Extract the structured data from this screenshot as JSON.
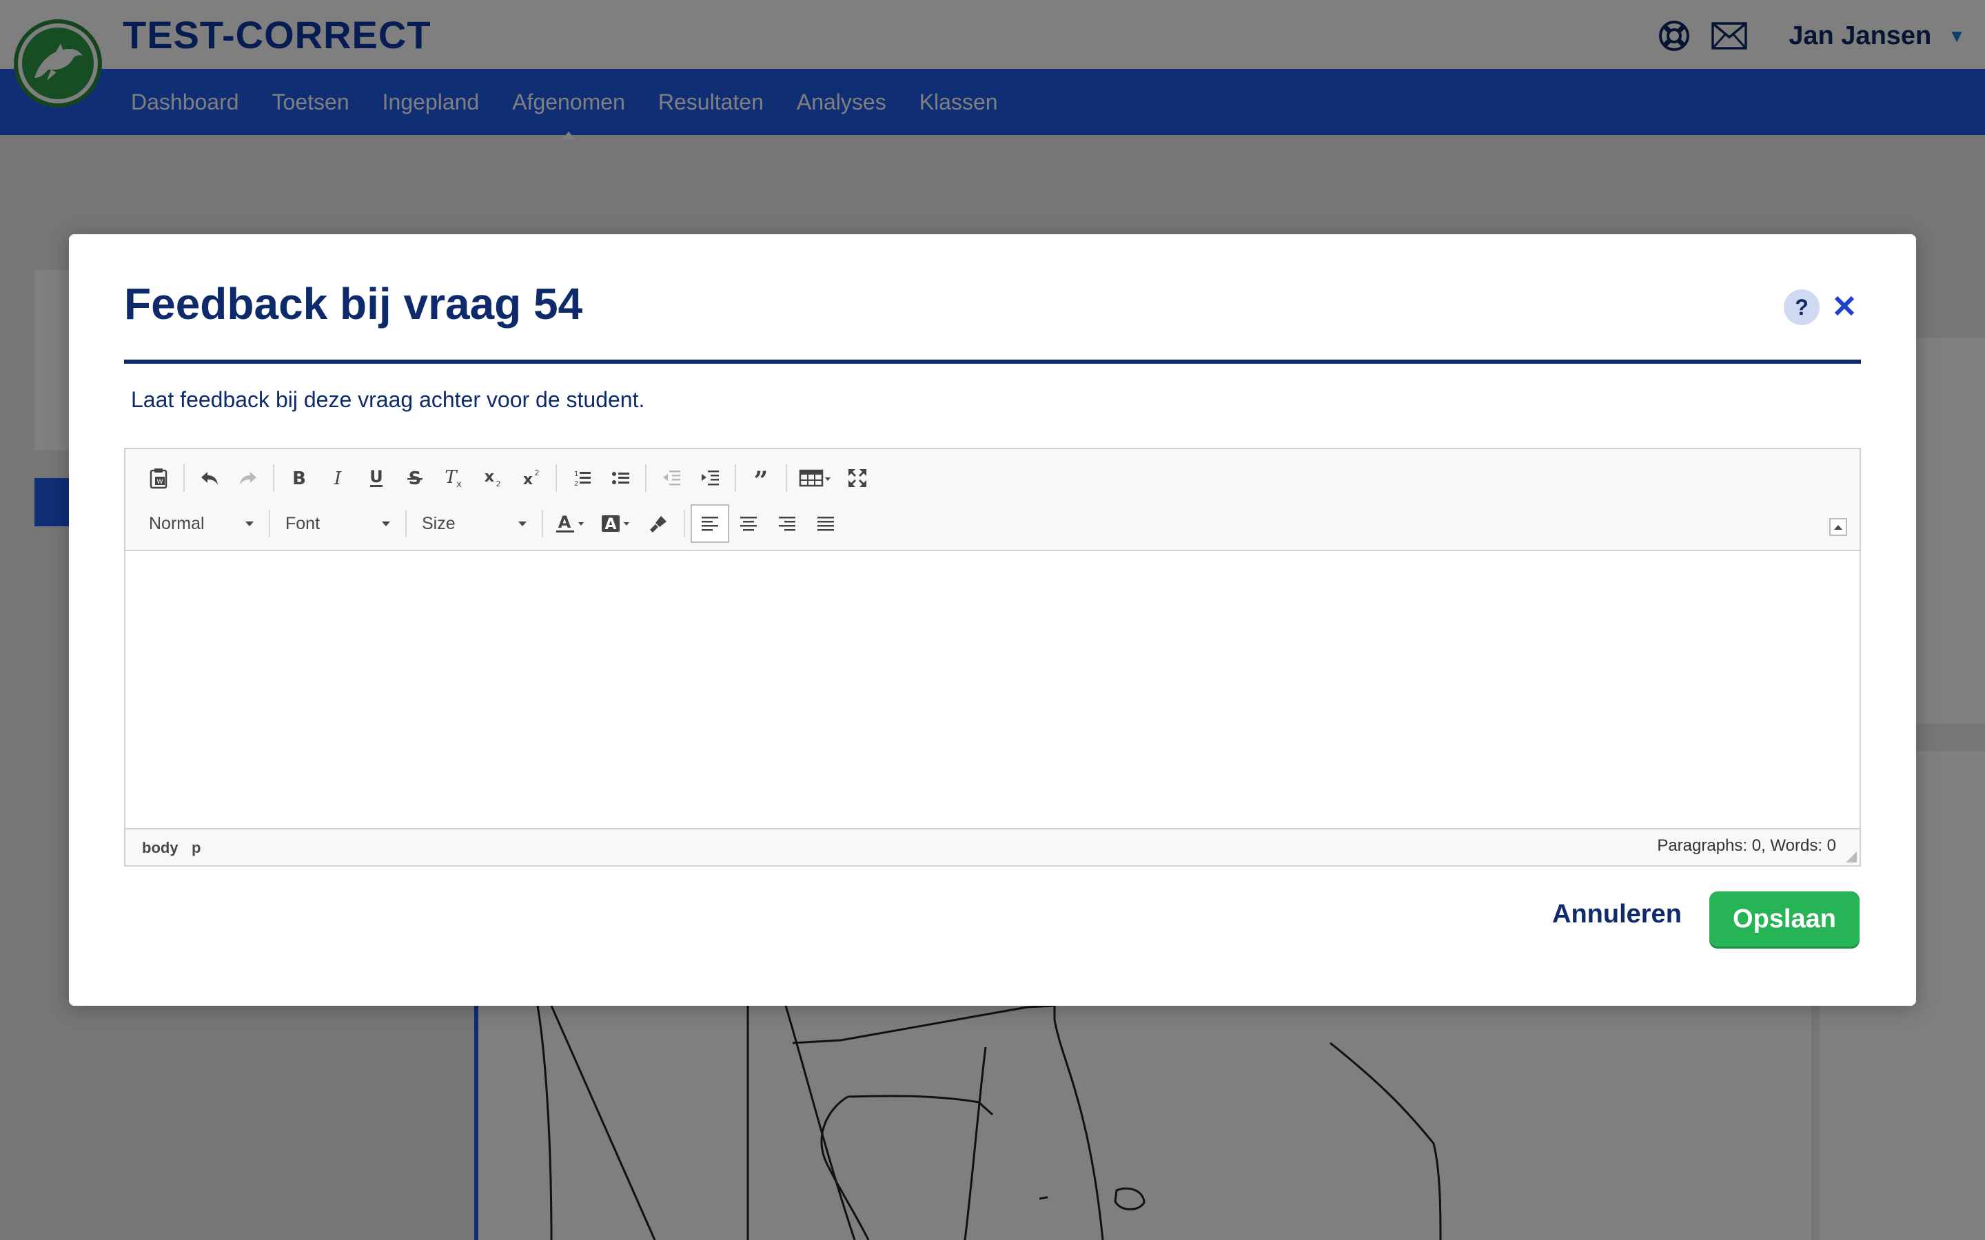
{
  "app": {
    "brand": "TEST-CORRECT",
    "user_name": "Jan Jansen",
    "nav": [
      {
        "label": "Dashboard"
      },
      {
        "label": "Toetsen"
      },
      {
        "label": "Ingepland"
      },
      {
        "label": "Afgenomen",
        "active": true
      },
      {
        "label": "Resultaten"
      },
      {
        "label": "Analyses"
      },
      {
        "label": "Klassen"
      }
    ],
    "icons": {
      "support": "lifebuoy-icon",
      "messages": "envelope-icon",
      "user_menu": "caret-down-icon",
      "logo": "dolphin-logo"
    },
    "colors": {
      "brand_blue": "#1f5ce8",
      "navy": "#0e2a6b",
      "save_green": "#27b456"
    }
  },
  "modal": {
    "title": "Feedback bij vraag 54",
    "description": "Laat feedback bij deze vraag achter voor de student.",
    "help_label": "?",
    "cancel_label": "Annuleren",
    "save_label": "Opslaan"
  },
  "editor": {
    "format_select": "Normal",
    "font_select": "Font",
    "size_select": "Size",
    "path": [
      "body",
      "p"
    ],
    "word_count": "Paragraphs: 0, Words: 0",
    "toolbar_row1": [
      "paste-from-word-icon",
      "undo-icon",
      "redo-icon",
      "bold-icon",
      "italic-icon",
      "underline-icon",
      "strikethrough-icon",
      "remove-format-icon",
      "subscript-icon",
      "superscript-icon",
      "numbered-list-icon",
      "bulleted-list-icon",
      "decrease-indent-icon",
      "increase-indent-icon",
      "blockquote-icon",
      "table-icon",
      "maximize-icon"
    ],
    "toolbar_row2": [
      "text-color-icon",
      "background-color-icon",
      "copy-formatting-icon",
      "align-left-icon",
      "align-center-icon",
      "align-right-icon",
      "justify-icon"
    ]
  }
}
